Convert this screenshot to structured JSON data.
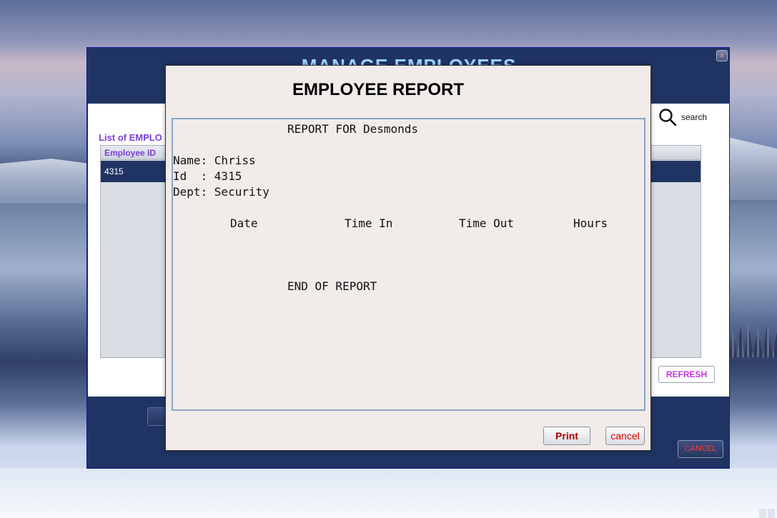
{
  "colors": {
    "window_dark_blue": "#203463",
    "header_purple": "#7b3fd6",
    "refresh_magenta": "#c038d8",
    "print_red": "#b00000",
    "cancel_red": "#e00000",
    "dialog_bg": "#f1ecea"
  },
  "main_window": {
    "title": "MANAGE EMPLOYEES",
    "close_label": "x",
    "list_label": "List of EMPLO",
    "search": {
      "icon": "search-icon",
      "label": "search"
    },
    "table": {
      "columns": [
        "Employee ID"
      ],
      "rows": [
        [
          "4315"
        ]
      ]
    },
    "refresh_label": "REFRESH",
    "cancel_label": "CANCEL"
  },
  "report_dialog": {
    "title": "EMPLOYEE REPORT",
    "report": {
      "heading": "REPORT FOR Desmonds",
      "name_line": "Name: Chriss",
      "id_line": "Id  : 4315",
      "dept_line": "Dept: Security",
      "columns": [
        "Date",
        "Time In",
        "Time Out",
        "Hours"
      ],
      "footer": "END OF REPORT"
    },
    "print_label": "Print",
    "cancel_label": "cancel"
  }
}
